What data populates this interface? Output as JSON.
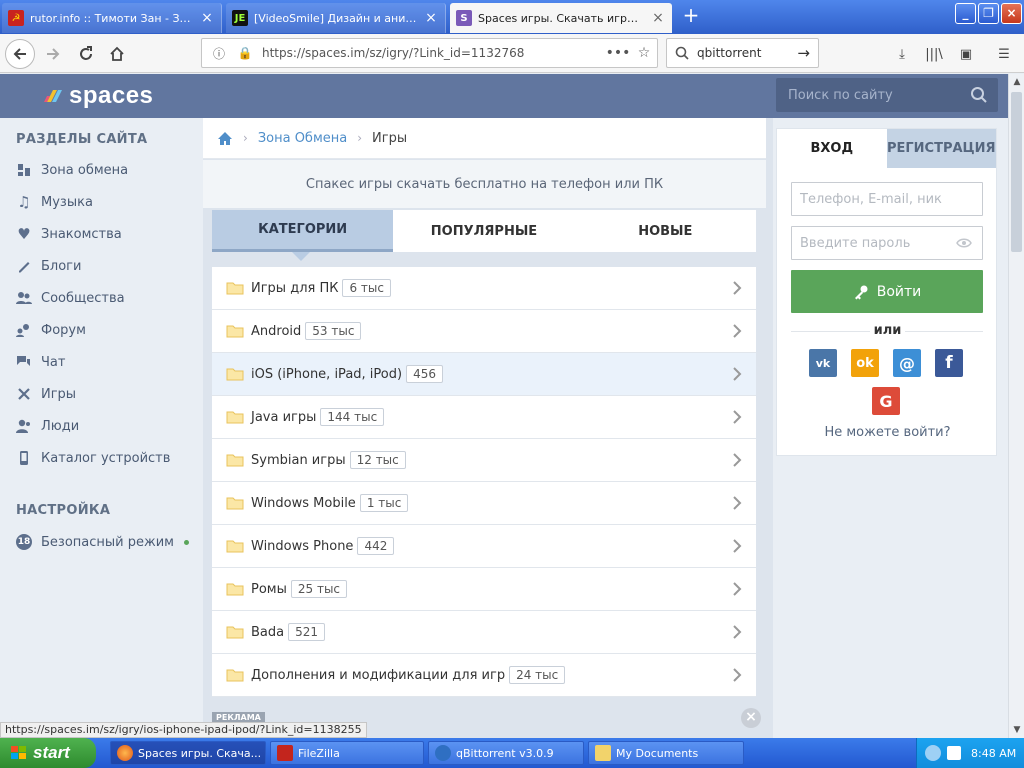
{
  "browser": {
    "tabs": [
      {
        "title": "rutor.info :: Тимоти Зан - Звёздн",
        "icon": "hammer-sickle-icon"
      },
      {
        "title": "[VideoSmile] Дизайн и анимация",
        "icon": "je-icon"
      },
      {
        "title": "Spaces игры. Скачать игры на т",
        "icon": "s-icon"
      }
    ],
    "new_tab": "+",
    "url": "https://spaces.im/sz/igry/?Link_id=1132768",
    "search_value": "qbittorrent",
    "status_url": "https://spaces.im/sz/igry/ios-iphone-ipad-ipod/?Link_id=1138255"
  },
  "site": {
    "logo_text": "spaces",
    "search_placeholder": "Поиск по сайту",
    "sidebar": {
      "section_title": "РАЗДЕЛЫ САЙТА",
      "items": [
        {
          "label": "Зона обмена",
          "icon": "exchange-icon"
        },
        {
          "label": "Музыка",
          "icon": "music-icon"
        },
        {
          "label": "Знакомства",
          "icon": "heart-icon"
        },
        {
          "label": "Блоги",
          "icon": "pen-icon"
        },
        {
          "label": "Сообщества",
          "icon": "community-icon"
        },
        {
          "label": "Форум",
          "icon": "forum-icon"
        },
        {
          "label": "Чат",
          "icon": "chat-icon"
        },
        {
          "label": "Игры",
          "icon": "games-icon"
        },
        {
          "label": "Люди",
          "icon": "people-icon"
        },
        {
          "label": "Каталог устройств",
          "icon": "phone-icon"
        }
      ],
      "settings_title": "НАСТРОЙКА",
      "safe_mode": {
        "label": "Безопасный режим",
        "badge": "18"
      }
    },
    "breadcrumb": {
      "link": "Зона Обмена",
      "current": "Игры"
    },
    "intro": "Спакес игры скачать бесплатно на телефон или ПК",
    "tabs": [
      "КАТЕГОРИИ",
      "ПОПУЛЯРНЫЕ",
      "НОВЫЕ"
    ],
    "categories": [
      {
        "name": "Игры для ПК",
        "count": "6 тыс"
      },
      {
        "name": "Android",
        "count": "53 тыс"
      },
      {
        "name": "iOS (iPhone, iPad, iPod)",
        "count": "456"
      },
      {
        "name": "Java игры",
        "count": "144 тыс"
      },
      {
        "name": "Symbian игры",
        "count": "12 тыс"
      },
      {
        "name": "Windows Mobile",
        "count": "1 тыс"
      },
      {
        "name": "Windows Phone",
        "count": "442"
      },
      {
        "name": "Ромы",
        "count": "25 тыс"
      },
      {
        "name": "Bada",
        "count": "521"
      },
      {
        "name": "Дополнения и модификации для игр",
        "count": "24 тыс"
      }
    ],
    "ad_label": "РЕКЛАМА",
    "login": {
      "tab_login": "ВХОД",
      "tab_register": "РЕГИСТРАЦИЯ",
      "login_placeholder": "Телефон, E-mail, ник",
      "password_placeholder": "Введите пароль",
      "submit": "Войти",
      "or": "или",
      "forgot": "Не можете войти?",
      "social": [
        {
          "name": "vk",
          "label": "vk",
          "color": "#4a76a8"
        },
        {
          "name": "odnoklassniki",
          "label": "ok",
          "color": "#f2a20a"
        },
        {
          "name": "mailru",
          "label": "@",
          "color": "#3d8fd6"
        },
        {
          "name": "facebook",
          "label": "f",
          "color": "#3b5998"
        },
        {
          "name": "google",
          "label": "G",
          "color": "#dd4b39"
        }
      ]
    },
    "colors": {
      "header": "#61769f",
      "accent": "#4f8ec9",
      "login_button": "#5aa55a"
    }
  },
  "taskbar": {
    "start": "start",
    "tasks": [
      {
        "label": "Spaces игры. Скача...",
        "icon": "firefox-icon",
        "active": true
      },
      {
        "label": "FileZilla",
        "icon": "filezilla-icon",
        "active": false
      },
      {
        "label": "qBittorrent v3.0.9",
        "icon": "qbittorrent-icon",
        "active": false
      },
      {
        "label": "My Documents",
        "icon": "folder-icon",
        "active": false
      }
    ],
    "clock": "8:48 AM"
  }
}
